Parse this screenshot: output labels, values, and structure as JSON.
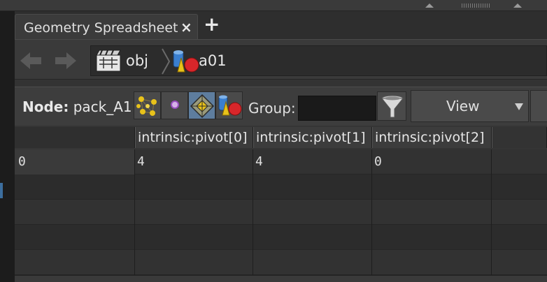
{
  "tab": {
    "title": "Geometry Spreadsheet",
    "close_label": "×",
    "add_label": "+"
  },
  "path": {
    "items": [
      {
        "label": "obj",
        "icon": "obj-network-icon"
      },
      {
        "label": "a01",
        "icon": "geometry-node-icon"
      }
    ]
  },
  "node": {
    "prefix": "Node:",
    "name": "pack_A1"
  },
  "toolbar": {
    "buttons": [
      "points-icon",
      "vertices-icon",
      "primitives-icon",
      "detail-icon"
    ],
    "group_label": "Group:",
    "group_value": "",
    "view_label": "View"
  },
  "table": {
    "columns": [
      "intrinsic:pivot[0]",
      "intrinsic:pivot[1]",
      "intrinsic:pivot[2]"
    ],
    "rows": [
      {
        "index": "0",
        "values": [
          "4",
          "4",
          "0"
        ]
      }
    ]
  },
  "colors": {
    "background": "#333333",
    "active_button": "#5e7d9e",
    "accent_yellow": "#e8c21a",
    "accent_red": "#d8262a",
    "accent_blue": "#3a7fd0"
  }
}
